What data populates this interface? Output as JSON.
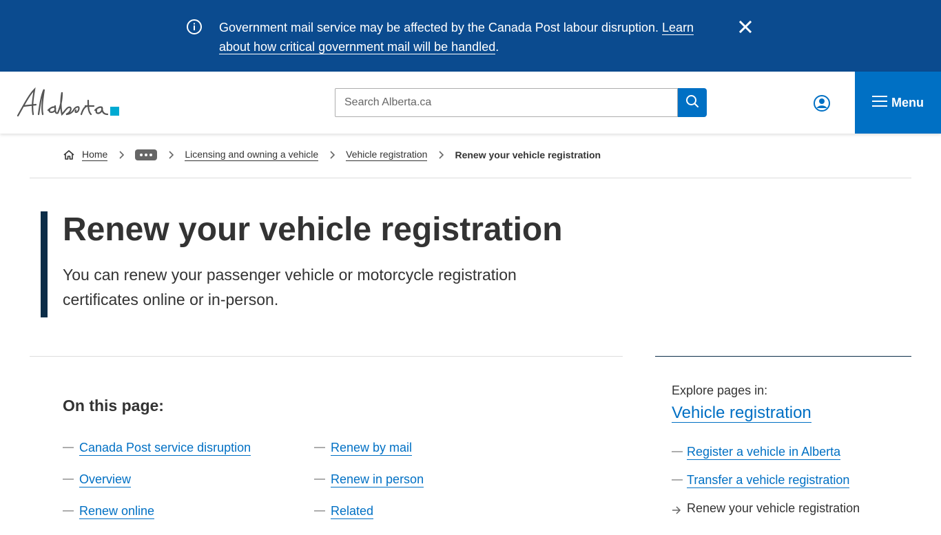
{
  "alert": {
    "message": "Government mail service may be affected by the Canada Post labour disruption.",
    "link_text": "Learn about how critical government mail will be handled",
    "trailing": "."
  },
  "header": {
    "logo_text": "Alberta",
    "search_placeholder": "Search Alberta.ca",
    "menu_label": "Menu"
  },
  "breadcrumb": {
    "home": "Home",
    "items": [
      "Licensing and owning a vehicle",
      "Vehicle registration"
    ],
    "current": "Renew your vehicle registration"
  },
  "hero": {
    "title": "Renew your vehicle registration",
    "lead": "You can renew your passenger vehicle or motorcycle registration certificates online or in-person."
  },
  "toc": {
    "title": "On this page:",
    "col1": [
      "Canada Post service disruption",
      "Overview",
      "Renew online"
    ],
    "col2": [
      "Renew by mail",
      "Renew in person",
      "Related"
    ]
  },
  "sidebar": {
    "label": "Explore pages in:",
    "heading": "Vehicle registration",
    "links": [
      "Register a vehicle in Alberta",
      "Transfer a vehicle registration"
    ],
    "current": "Renew your vehicle registration"
  },
  "colors": {
    "banner": "#0b4b8f",
    "accent": "#0070c4",
    "hero_bar": "#0c2d48",
    "logo_square": "#00aad2"
  }
}
